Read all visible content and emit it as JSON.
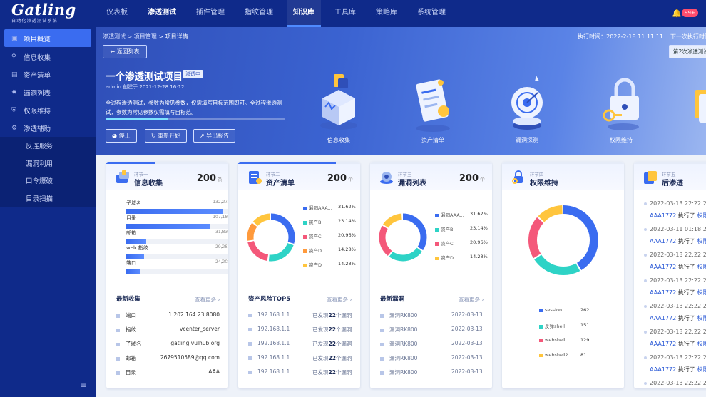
{
  "brand": {
    "name": "Gatling",
    "subtitle": "自动化渗透测试系统"
  },
  "nav": {
    "items": [
      "仪表板",
      "渗透测试",
      "插件管理",
      "指纹管理",
      "知识库",
      "工具库",
      "策略库",
      "系统管理"
    ],
    "notify_badge": "99+"
  },
  "sidebar": {
    "items": [
      {
        "label": "项目概览",
        "icon": "monitor-icon"
      },
      {
        "label": "信息收集",
        "icon": "search-icon"
      },
      {
        "label": "资产清单",
        "icon": "list-icon"
      },
      {
        "label": "漏洞列表",
        "icon": "bug-icon"
      },
      {
        "label": "权限维持",
        "icon": "shield-icon"
      },
      {
        "label": "渗透辅助",
        "icon": "tool-icon"
      }
    ],
    "sub_items": [
      "反连服务",
      "漏洞利用",
      "口令爆破",
      "目录扫描"
    ]
  },
  "header": {
    "breadcrumb": [
      "渗透测试",
      "项目管理",
      "项目详情"
    ],
    "exec_time_label": "执行时间：",
    "exec_time": "2022-2-18 11:11:11",
    "next_exec_label": "下一次执行时间：",
    "back_button": "返回列表",
    "next_run_button": "第2次渗透测试报告"
  },
  "project": {
    "title": "一个渗透测试项目",
    "status": "渗透中",
    "creator": "admin",
    "created_label": "创建于",
    "created_at": "2021-12-28 16:12",
    "description": "全过程渗透测试，参数为常见参数，仅需填写目标范围即可。全过程渗透测试，参数为常见参数仅需填写目标范。",
    "progress": 0.35,
    "buttons": {
      "stop": "停止",
      "restart": "重新开始",
      "export": "导出报告"
    }
  },
  "stages": [
    "信息收集",
    "资产清单",
    "漏洞探测",
    "权限维持"
  ],
  "cards": {
    "info": {
      "step": "环节一",
      "title": "信息收集",
      "count": "200",
      "unit": "条",
      "bars": [
        {
          "label": "子域名",
          "value": "132,271",
          "ratio": 0.93
        },
        {
          "label": "目录",
          "value": "107,189",
          "ratio": 0.8
        },
        {
          "label": "邮箱",
          "value": "31,839",
          "ratio": 0.19
        },
        {
          "label": "web 指纹",
          "value": "29,281",
          "ratio": 0.17
        },
        {
          "label": "端口",
          "value": "24,208",
          "ratio": 0.14
        }
      ],
      "recent_title": "最新收集",
      "more": "查看更多",
      "recent": [
        {
          "type": "端口",
          "value": "1.202.164.23:8080"
        },
        {
          "type": "指纹",
          "value": "vcenter_server"
        },
        {
          "type": "子域名",
          "value": "gatling.vulhub.org"
        },
        {
          "type": "邮箱",
          "value": "2679510589@qq.com"
        },
        {
          "type": "目录",
          "value": "AAA"
        }
      ]
    },
    "assets": {
      "step": "环节二",
      "title": "资产清单",
      "count": "200",
      "unit": "个",
      "legend": [
        {
          "name": "漏洞AAA...",
          "value": "31.62%",
          "color": "#3a6cf0"
        },
        {
          "name": "资产B",
          "value": "23.14%",
          "color": "#2ed3c6"
        },
        {
          "name": "资产C",
          "value": "20.96%",
          "color": "#f4587a"
        },
        {
          "name": "资产D",
          "value": "14.28%",
          "color": "#ff9a3c"
        },
        {
          "name": "资产D",
          "value": "14.28%",
          "color": "#ffc53d"
        }
      ],
      "risk_title": "资产风险TOP5",
      "more": "查看更多",
      "risks": [
        {
          "ip": "192.168.1.1",
          "pre": "已发现",
          "num": "22",
          "post": "个漏洞"
        },
        {
          "ip": "192.168.1.1",
          "pre": "已发现",
          "num": "22",
          "post": "个漏洞"
        },
        {
          "ip": "192.168.1.1",
          "pre": "已发现",
          "num": "22",
          "post": "个漏洞"
        },
        {
          "ip": "192.168.1.1",
          "pre": "已发现",
          "num": "22",
          "post": "个漏洞"
        },
        {
          "ip": "192.168.1.1",
          "pre": "已发现",
          "num": "22",
          "post": "个漏洞"
        }
      ]
    },
    "vulns": {
      "step": "环节三",
      "title": "漏洞列表",
      "count": "200",
      "unit": "个",
      "legend": [
        {
          "name": "漏洞AAA...",
          "value": "31.62%",
          "color": "#3a6cf0"
        },
        {
          "name": "资产B",
          "value": "23.14%",
          "color": "#2ed3c6"
        },
        {
          "name": "资产C",
          "value": "20.96%",
          "color": "#f4587a"
        },
        {
          "name": "资产D",
          "value": "14.28%",
          "color": "#ffc53d"
        }
      ],
      "latest_title": "最新漏洞",
      "more": "查看更多",
      "latest": [
        {
          "name": "漏洞RK800",
          "date": "2022-03-13"
        },
        {
          "name": "漏洞RK800",
          "date": "2022-03-13"
        },
        {
          "name": "漏洞RK800",
          "date": "2022-03-13"
        },
        {
          "name": "漏洞RK800",
          "date": "2022-03-13"
        },
        {
          "name": "漏洞RK800",
          "date": "2022-03-13"
        }
      ]
    },
    "persist": {
      "step": "环节四",
      "title": "权限维持",
      "legend": [
        {
          "name": "session",
          "value": "262",
          "color": "#3a6cf0"
        },
        {
          "name": "反弹shell",
          "value": "151",
          "color": "#2ed3c6"
        },
        {
          "name": "webshell",
          "value": "129",
          "color": "#f4587a"
        },
        {
          "name": "webshell2",
          "value": "81",
          "color": "#ffc53d"
        }
      ]
    },
    "post": {
      "step": "环节五",
      "title": "后渗透",
      "timeline": [
        {
          "time": "2022-03-13 22:22:22",
          "user": "AAA1772",
          "action": "执行了",
          "target": "权限"
        },
        {
          "time": "2022-03-11 01:18:25",
          "user": "AAA1772",
          "action": "执行了",
          "target": "权限"
        },
        {
          "time": "2022-03-13 22:22:22",
          "user": "AAA1772",
          "action": "执行了",
          "target": "权限"
        },
        {
          "time": "2022-03-13 22:22:22",
          "user": "AAA1772",
          "action": "执行了",
          "target": "权限"
        },
        {
          "time": "2022-03-13 22:22:22",
          "user": "AAA1772",
          "action": "执行了",
          "target": "权限"
        },
        {
          "time": "2022-03-13 22:22:22",
          "user": "AAA1772",
          "action": "执行了",
          "target": "权限"
        },
        {
          "time": "2022-03-13 22:22:22",
          "user": "AAA1772",
          "action": "执行了",
          "target": "权限"
        },
        {
          "time": "2022-03-13 22:22:22",
          "user": "AAA1772",
          "action": "执行了",
          "target": "权限"
        }
      ]
    }
  }
}
